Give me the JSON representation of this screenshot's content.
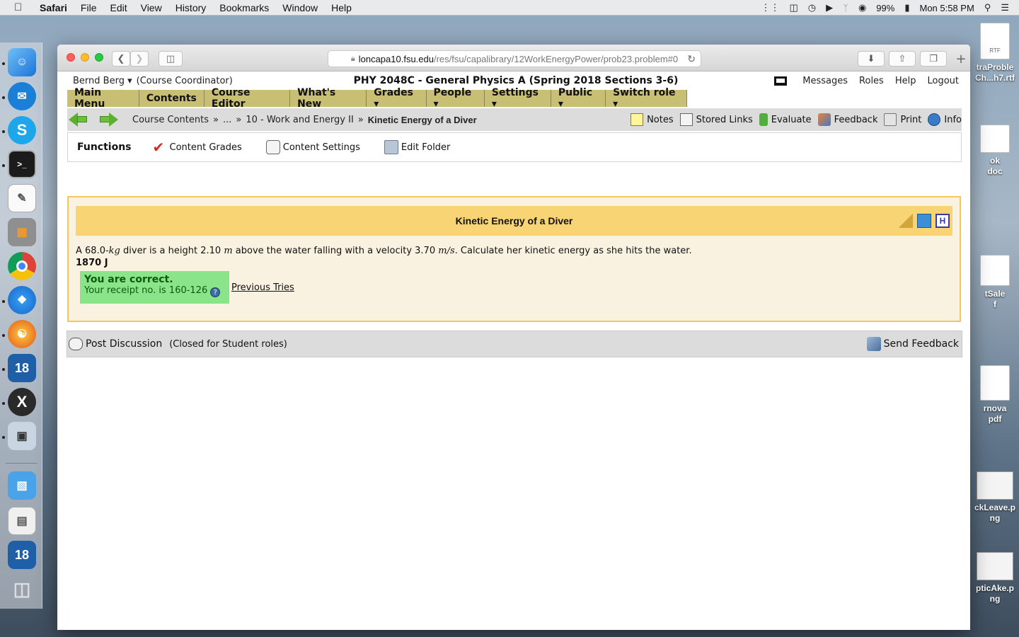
{
  "menubar": {
    "app": "Safari",
    "items": [
      "File",
      "Edit",
      "View",
      "History",
      "Bookmarks",
      "Window",
      "Help"
    ],
    "battery": "99%",
    "clock": "Mon 5:58 PM"
  },
  "browser": {
    "url_host": "loncapa10.fsu.edu",
    "url_path": "/res/fsu/capalibrary/12WorkEnergyPower/prob23.problem#0"
  },
  "header": {
    "user": "Bernd Berg",
    "role": "(Course Coordinator)",
    "course_title": "PHY 2048C - General Physics A (Spring 2018 Sections 3-6)",
    "links": [
      "Messages",
      "Roles",
      "Help",
      "Logout"
    ]
  },
  "main_menu": [
    {
      "label": "Main Menu"
    },
    {
      "label": "Contents"
    },
    {
      "label": "Course Editor"
    },
    {
      "label": "What's New"
    },
    {
      "label": "Grades ▾"
    },
    {
      "label": "People ▾"
    },
    {
      "label": "Settings ▾"
    },
    {
      "label": "Public ▾"
    },
    {
      "label": "Switch role ▾"
    }
  ],
  "breadcrumb": {
    "root": "Course Contents",
    "ellipsis": "...",
    "folder": "10 - Work and Energy II",
    "current": "Kinetic Energy of a Diver"
  },
  "nav_tools": [
    "Notes",
    "Stored Links",
    "Evaluate",
    "Feedback",
    "Print",
    "Info"
  ],
  "functions": {
    "title": "Functions",
    "items": [
      "Content Grades",
      "Content Settings",
      "Edit Folder"
    ]
  },
  "problem": {
    "title": "Kinetic Energy of a Diver",
    "text_a": "A 68.0-",
    "unit_mass": "kg",
    "text_b": " diver is a height 2.10 ",
    "unit_len": "m",
    "text_c": " above the water falling with a velocity 3.70 ",
    "unit_vel": "m/s",
    "text_d": ". Calculate her kinetic energy as she hits the water.",
    "answer": "1870 J",
    "feedback_title": "You are correct.",
    "receipt": "Your receipt no. is 160-126",
    "previous_tries": "Previous Tries"
  },
  "discussion": {
    "post": "Post Discussion",
    "closed": "(Closed for Student roles)",
    "send_feedback": "Send Feedback"
  },
  "desktop_files": [
    {
      "label": "traProble",
      "label2": "Ch...h7.rtf"
    },
    {
      "label": "ok",
      "label2": "doc"
    },
    {
      "label": "tSale",
      "label2": "f"
    },
    {
      "label": "rnova",
      "label2": "pdf"
    },
    {
      "label": "ckLeave.p",
      "label2": "ng"
    },
    {
      "label": "pticAke.p",
      "label2": "ng"
    }
  ]
}
